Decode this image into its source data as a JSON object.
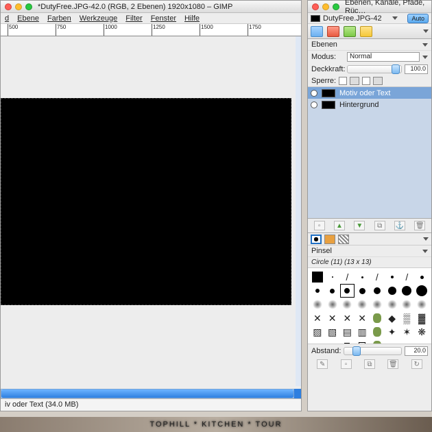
{
  "main": {
    "title": "*DutyFree.JPG-42.0 (RGB, 2 Ebenen) 1920x1080 – GIMP",
    "menu": [
      "d",
      "Ebene",
      "Farben",
      "Werkzeuge",
      "Filter",
      "Fenster",
      "Hilfe"
    ],
    "ruler_ticks": [
      "500",
      "750",
      "1000",
      "1250",
      "1500",
      "1750"
    ],
    "status": "iv oder Text (34.0 MB)"
  },
  "dock": {
    "title": "Ebenen, Kanäle, Pfade, Rüc…",
    "auto": "Auto",
    "image_name": "DutyFree.JPG-42",
    "layers_section": "Ebenen",
    "mode_label": "Modus:",
    "mode_value": "Normal",
    "opacity_label": "Deckkraft:",
    "opacity_value": "100.0",
    "lock_label": "Sperre:",
    "layers": [
      {
        "name": "Motiv oder Text",
        "selected": true
      },
      {
        "name": "Hintergrund",
        "selected": false
      }
    ],
    "brush_section": "Pinsel",
    "brush_name": "Circle (11) (13 x 13)",
    "spacing_label": "Abstand:",
    "spacing_value": "20.0"
  },
  "watermark": "TOPHILL * KITCHEN * TOUR"
}
